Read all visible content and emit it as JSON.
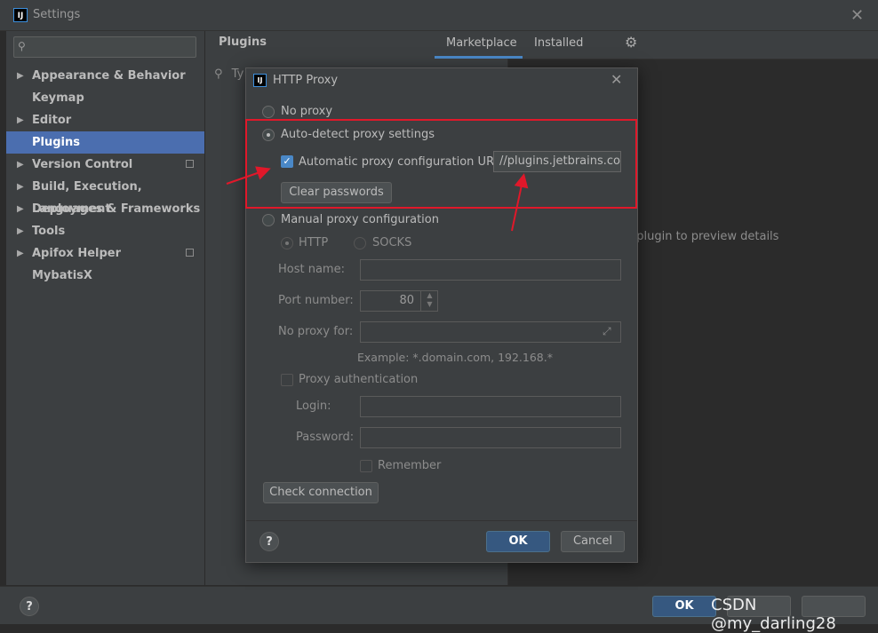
{
  "window": {
    "title": "Settings",
    "logo": "IJ"
  },
  "sidebar": {
    "search_placeholder": "",
    "items": [
      {
        "label": "Appearance & Behavior",
        "expandable": true
      },
      {
        "label": "Keymap",
        "expandable": false
      },
      {
        "label": "Editor",
        "expandable": true
      },
      {
        "label": "Plugins",
        "expandable": false,
        "selected": true
      },
      {
        "label": "Version Control",
        "expandable": true
      },
      {
        "label": "Build, Execution, Deployment",
        "expandable": true
      },
      {
        "label": "Languages & Frameworks",
        "expandable": true
      },
      {
        "label": "Tools",
        "expandable": true
      },
      {
        "label": "Apifox Helper",
        "expandable": true
      },
      {
        "label": "MybatisX",
        "expandable": false
      }
    ]
  },
  "plugins": {
    "title": "Plugins",
    "tabs": [
      "Marketplace",
      "Installed"
    ],
    "active_tab": "Marketplace",
    "search_placeholder": "Ty",
    "hint": "t plugin to preview details"
  },
  "dialog": {
    "title": "HTTP Proxy",
    "logo": "IJ",
    "no_proxy": "No proxy",
    "auto_detect": "Auto-detect proxy settings",
    "auto_config_label": "Automatic proxy configuration URL:",
    "auto_config_url": "//plugins.jetbrains.com",
    "clear_passwords": "Clear passwords",
    "manual": "Manual proxy configuration",
    "http": "HTTP",
    "socks": "SOCKS",
    "host_label": "Host name:",
    "host_value": "",
    "port_label": "Port number:",
    "port_value": "80",
    "noproxy_label": "No proxy for:",
    "noproxy_value": "",
    "example": "Example: *.domain.com, 192.168.*",
    "proxy_auth": "Proxy authentication",
    "login_label": "Login:",
    "login_value": "",
    "password_label": "Password:",
    "password_value": "",
    "remember": "Remember",
    "check_connection": "Check connection",
    "help": "?",
    "ok": "OK",
    "cancel": "Cancel"
  },
  "footer": {
    "help": "?",
    "ok": "OK"
  },
  "watermark": "CSDN @my_darling28",
  "colors": {
    "accent": "#4a88c7",
    "selected": "#4b6eaf",
    "highlight": "#e0182a"
  }
}
